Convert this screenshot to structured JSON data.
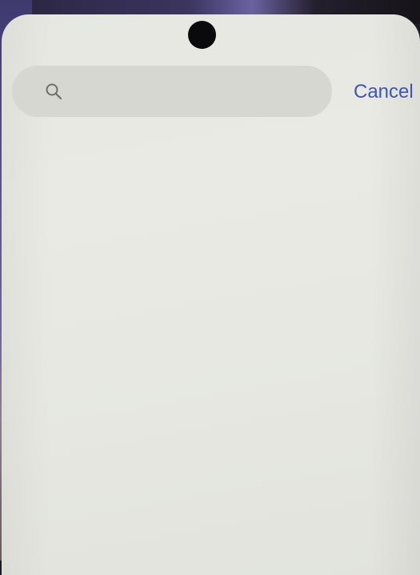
{
  "search": {
    "placeholder": "",
    "value": "",
    "icon": "search-icon"
  },
  "actions": {
    "cancel_label": "Cancel"
  },
  "colors": {
    "accent": "#3b56b8",
    "screen_background": "#e8e9e3",
    "search_bar_background": "#d6d7d1"
  }
}
